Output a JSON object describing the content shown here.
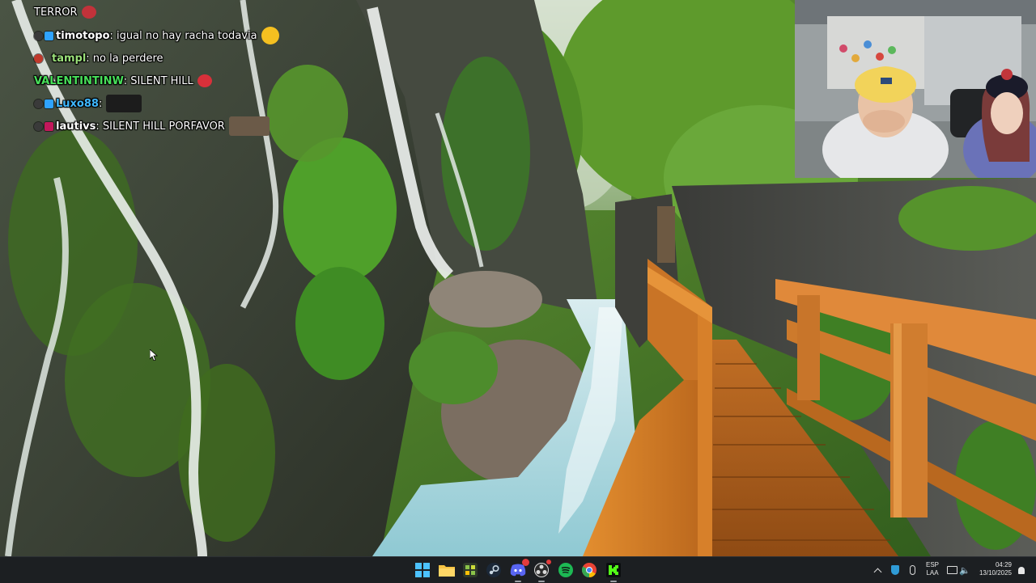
{
  "chat": {
    "messages": [
      {
        "user": "",
        "text": "TERROR",
        "user_color": "#ffffff"
      },
      {
        "user": "timotopo",
        "text": ": igual no hay racha todavia",
        "user_color": "#ffffff"
      },
      {
        "user": "tampl",
        "text": " : no la perdere",
        "user_color": "#9be07a"
      },
      {
        "user": "VALENTINTINW",
        "text": ": SILENT HILL",
        "user_color": "#48e05a"
      },
      {
        "user": "Luxo88",
        "text": ":",
        "user_color": "#3fb8ff"
      },
      {
        "user": "lautivs",
        "text": ": SILENT HILL PORFAVOR",
        "user_color": "#ffffff"
      }
    ]
  },
  "taskbar": {
    "apps": [
      {
        "name": "Start",
        "icon": "windows-start-icon",
        "color": "#3fa3ff"
      },
      {
        "name": "File Explorer",
        "icon": "folder-icon",
        "color": "#f6c343"
      },
      {
        "name": "Stream Deck",
        "icon": "app-grid-icon",
        "color": "#8bc34a"
      },
      {
        "name": "Steam",
        "icon": "steam-icon",
        "color": "#c7d5e0"
      },
      {
        "name": "Discord",
        "icon": "discord-icon",
        "color": "#5865f2",
        "badge": "9+"
      },
      {
        "name": "OBS",
        "icon": "obs-icon",
        "color": "#d9d9d9"
      },
      {
        "name": "Spotify",
        "icon": "spotify-icon",
        "color": "#1db954"
      },
      {
        "name": "Chrome",
        "icon": "chrome-icon",
        "color": "#ea4335"
      },
      {
        "name": "Kick",
        "icon": "kick-icon",
        "color": "#53fc18"
      }
    ],
    "tray": {
      "lang_line1": "ESP",
      "lang_line2": "LAA",
      "time": "04:29",
      "date": "13/10/2025"
    }
  },
  "colors": {
    "accent": "#53fc18",
    "taskbar_bg": "#1c1f22",
    "wood": "#d9822b"
  }
}
